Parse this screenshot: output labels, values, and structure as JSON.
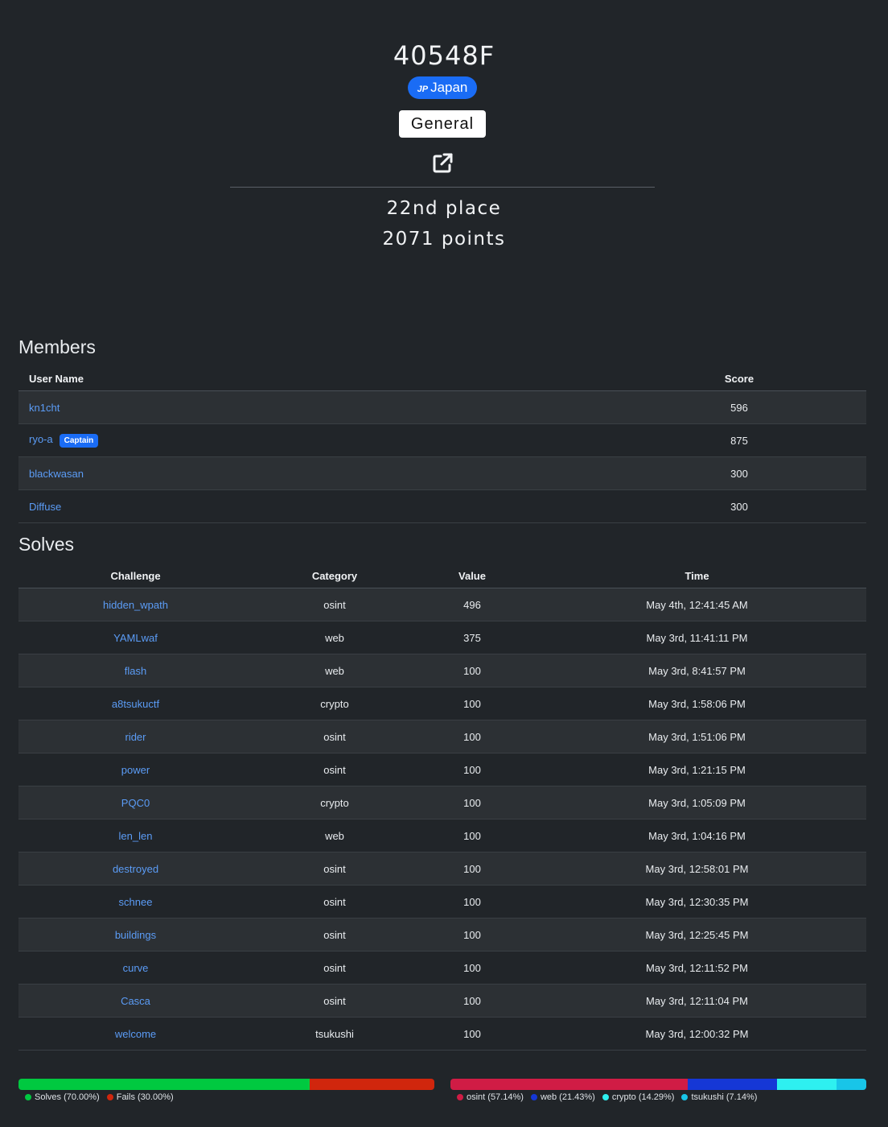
{
  "team": {
    "name": "40548F",
    "country_code": "JP",
    "country": "Japan",
    "bracket": "General",
    "external_link_icon": "external-link-icon",
    "place": "22nd place",
    "points": "2071 points"
  },
  "members": {
    "title": "Members",
    "headers": {
      "user": "User Name",
      "score": "Score"
    },
    "rows": [
      {
        "name": "kn1cht",
        "score": "596",
        "captain": ""
      },
      {
        "name": "ryo-a",
        "score": "875",
        "captain": "Captain"
      },
      {
        "name": "blackwasan",
        "score": "300",
        "captain": ""
      },
      {
        "name": "Diffuse",
        "score": "300",
        "captain": ""
      }
    ]
  },
  "solves": {
    "title": "Solves",
    "headers": {
      "challenge": "Challenge",
      "category": "Category",
      "value": "Value",
      "time": "Time"
    },
    "rows": [
      {
        "challenge": "hidden_wpath",
        "category": "osint",
        "value": "496",
        "time": "May 4th, 12:41:45 AM"
      },
      {
        "challenge": "YAMLwaf",
        "category": "web",
        "value": "375",
        "time": "May 3rd, 11:41:11 PM"
      },
      {
        "challenge": "flash",
        "category": "web",
        "value": "100",
        "time": "May 3rd, 8:41:57 PM"
      },
      {
        "challenge": "a8tsukuctf",
        "category": "crypto",
        "value": "100",
        "time": "May 3rd, 1:58:06 PM"
      },
      {
        "challenge": "rider",
        "category": "osint",
        "value": "100",
        "time": "May 3rd, 1:51:06 PM"
      },
      {
        "challenge": "power",
        "category": "osint",
        "value": "100",
        "time": "May 3rd, 1:21:15 PM"
      },
      {
        "challenge": "PQC0",
        "category": "crypto",
        "value": "100",
        "time": "May 3rd, 1:05:09 PM"
      },
      {
        "challenge": "len_len",
        "category": "web",
        "value": "100",
        "time": "May 3rd, 1:04:16 PM"
      },
      {
        "challenge": "destroyed",
        "category": "osint",
        "value": "100",
        "time": "May 3rd, 12:58:01 PM"
      },
      {
        "challenge": "schnee",
        "category": "osint",
        "value": "100",
        "time": "May 3rd, 12:30:35 PM"
      },
      {
        "challenge": "buildings",
        "category": "osint",
        "value": "100",
        "time": "May 3rd, 12:25:45 PM"
      },
      {
        "challenge": "curve",
        "category": "osint",
        "value": "100",
        "time": "May 3rd, 12:11:52 PM"
      },
      {
        "challenge": "Casca",
        "category": "osint",
        "value": "100",
        "time": "May 3rd, 12:11:04 PM"
      },
      {
        "challenge": "welcome",
        "category": "tsukushi",
        "value": "100",
        "time": "May 3rd, 12:00:32 PM"
      }
    ]
  },
  "chart_data": [
    {
      "type": "bar",
      "categories": [
        "Solves",
        "Fails"
      ],
      "values": [
        70.0,
        30.0
      ],
      "legend": [
        "Solves (70.00%)",
        "Fails (30.00%)"
      ],
      "colors": [
        "#00c940",
        "#d0260d"
      ]
    },
    {
      "type": "bar",
      "categories": [
        "osint",
        "web",
        "crypto",
        "tsukushi"
      ],
      "values": [
        57.14,
        21.43,
        14.29,
        7.14
      ],
      "legend": [
        "osint (57.14%)",
        "web (21.43%)",
        "crypto (14.29%)",
        "tsukushi (7.14%)"
      ],
      "colors": [
        "#d01c45",
        "#1537d6",
        "#2ef0f0",
        "#18c5e8"
      ]
    }
  ]
}
